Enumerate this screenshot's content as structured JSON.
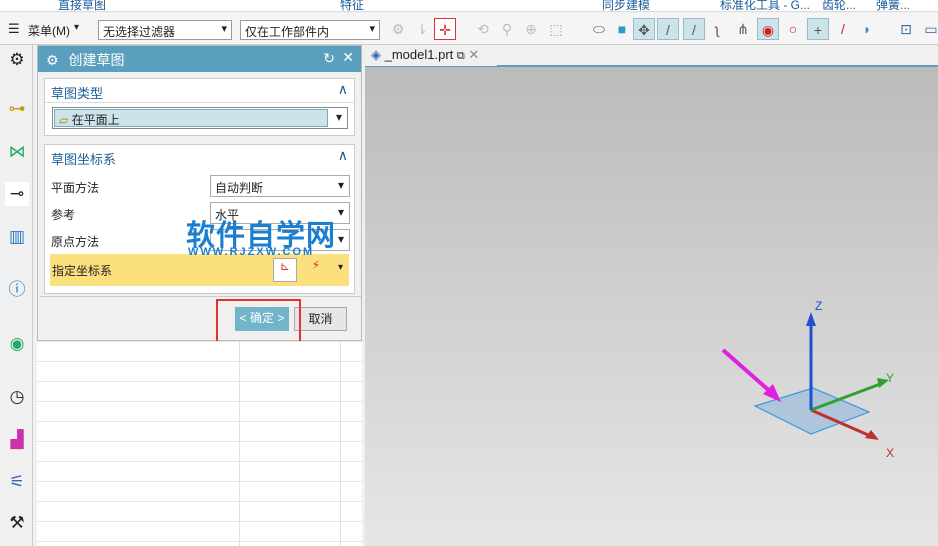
{
  "ribbon": {
    "groups": [
      "直接草图",
      "特征",
      "同步建模",
      "标准化工具 - G...",
      "齿轮...",
      "弹簧..."
    ]
  },
  "toolbar": {
    "menu_label": "菜单(M)",
    "filter": "无选择过滤器",
    "scope": "仅在工作部件内"
  },
  "dialog": {
    "title": "创建草图",
    "sketch_type": {
      "header": "草图类型",
      "value": "在平面上"
    },
    "csys": {
      "header": "草图坐标系",
      "rows": [
        {
          "label": "平面方法",
          "value": "自动判断"
        },
        {
          "label": "参考",
          "value": "水平"
        },
        {
          "label": "原点方法",
          "value": ""
        }
      ],
      "specify": "指定坐标系"
    },
    "ok": "< 确定 >",
    "cancel": "取消"
  },
  "watermark": {
    "title": "软件自学网",
    "url": "WWW.RJZXW.COM"
  },
  "viewport": {
    "tab": "_model1.prt",
    "axes": {
      "x": "X",
      "y": "Y",
      "z": "Z"
    },
    "colors": {
      "x": "#d03030",
      "y": "#30a030",
      "z": "#2050d0",
      "plane": "#3399dd",
      "arrow": "#e020e0",
      "highlight": "#e83030"
    }
  }
}
